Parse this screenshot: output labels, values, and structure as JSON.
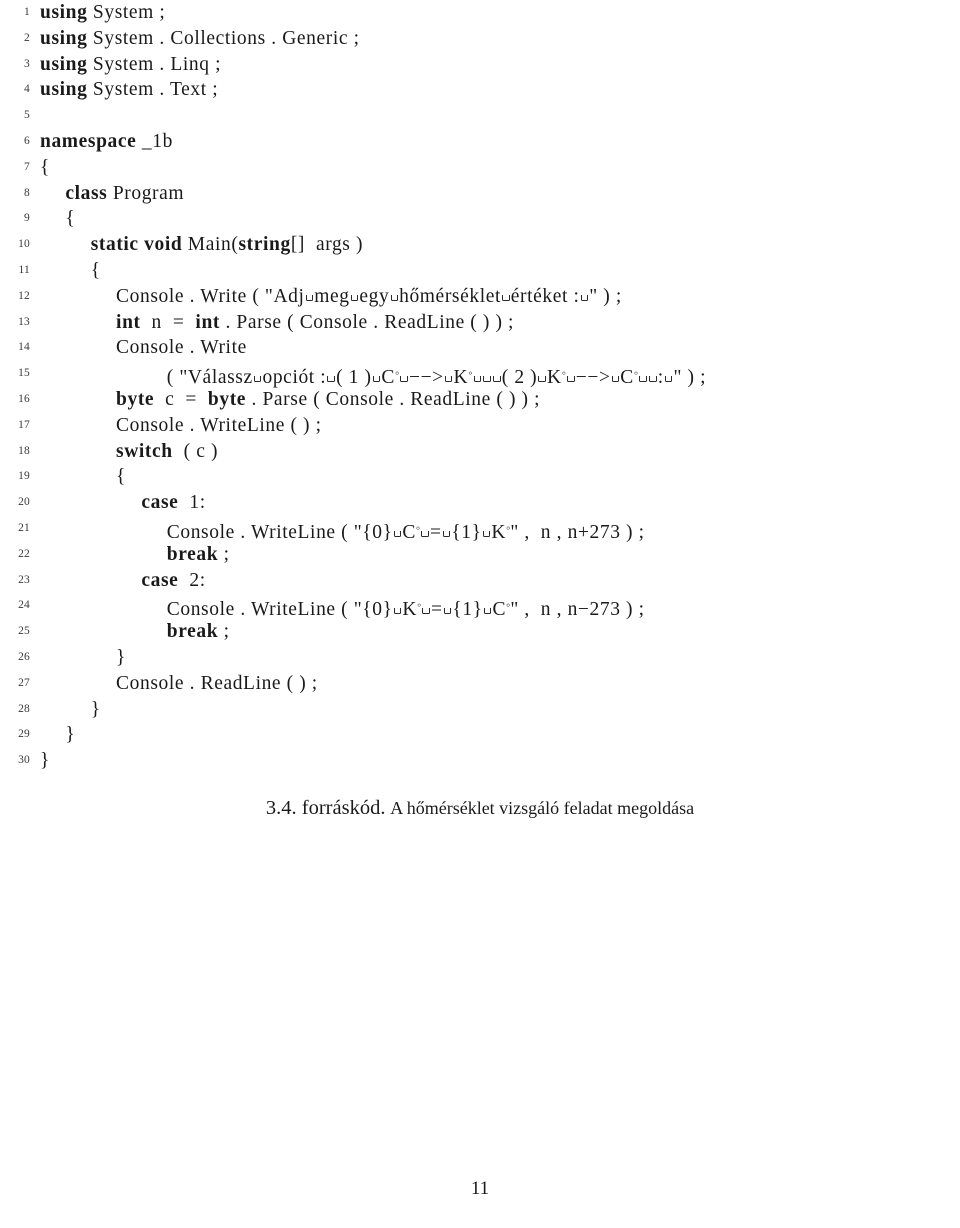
{
  "document": {
    "kind": "latex-code-listing",
    "language": "C#",
    "page_number": "11"
  },
  "listing": {
    "lines": [
      {
        "no": "1",
        "indent": 0,
        "tokens": [
          {
            "t": "kw",
            "v": "using"
          },
          {
            "t": "id",
            "v": " System ;"
          }
        ]
      },
      {
        "no": "2",
        "indent": 0,
        "tokens": [
          {
            "t": "kw",
            "v": "using"
          },
          {
            "t": "id",
            "v": " System . Collections . Generic ;"
          }
        ]
      },
      {
        "no": "3",
        "indent": 0,
        "tokens": [
          {
            "t": "kw",
            "v": "using"
          },
          {
            "t": "id",
            "v": " System . Linq ;"
          }
        ]
      },
      {
        "no": "4",
        "indent": 0,
        "tokens": [
          {
            "t": "kw",
            "v": "using"
          },
          {
            "t": "id",
            "v": " System . Text ;"
          }
        ]
      },
      {
        "no": "5",
        "indent": 0,
        "tokens": []
      },
      {
        "no": "6",
        "indent": 0,
        "tokens": [
          {
            "t": "kw",
            "v": "namespace"
          },
          {
            "t": "id",
            "v": " _1b"
          }
        ]
      },
      {
        "no": "7",
        "indent": 0,
        "tokens": [
          {
            "t": "id",
            "v": "{"
          }
        ]
      },
      {
        "no": "8",
        "indent": 1,
        "tokens": [
          {
            "t": "kw",
            "v": "class"
          },
          {
            "t": "id",
            "v": " Program"
          }
        ]
      },
      {
        "no": "9",
        "indent": 1,
        "tokens": [
          {
            "t": "id",
            "v": "{"
          }
        ]
      },
      {
        "no": "10",
        "indent": 2,
        "tokens": [
          {
            "t": "kw",
            "v": "static void"
          },
          {
            "t": "id",
            "v": " Main("
          },
          {
            "t": "kw",
            "v": "string"
          },
          {
            "t": "id",
            "v": "[]  args )"
          }
        ]
      },
      {
        "no": "11",
        "indent": 2,
        "tokens": [
          {
            "t": "id",
            "v": "{"
          }
        ]
      },
      {
        "no": "12",
        "indent": 3,
        "tokens": [
          {
            "t": "id",
            "v": "Console . Write ( \"Adj"
          },
          {
            "t": "sp"
          },
          {
            "t": "id",
            "v": "meg"
          },
          {
            "t": "sp"
          },
          {
            "t": "id",
            "v": "egy"
          },
          {
            "t": "sp"
          },
          {
            "t": "id",
            "v": "hőmérséklet"
          },
          {
            "t": "sp"
          },
          {
            "t": "id",
            "v": "értéket :"
          },
          {
            "t": "sp"
          },
          {
            "t": "id",
            "v": "\" ) ;"
          }
        ]
      },
      {
        "no": "13",
        "indent": 3,
        "tokens": [
          {
            "t": "kw",
            "v": "int"
          },
          {
            "t": "id",
            "v": "  n  =  "
          },
          {
            "t": "kw",
            "v": "int"
          },
          {
            "t": "id",
            "v": " . Parse ( Console . ReadLine ( ) ) ;"
          }
        ]
      },
      {
        "no": "14",
        "indent": 3,
        "tokens": [
          {
            "t": "id",
            "v": "Console . Write"
          }
        ]
      },
      {
        "no": "15",
        "indent": 5,
        "tokens": [
          {
            "t": "id",
            "v": "( \"Válassz"
          },
          {
            "t": "sp"
          },
          {
            "t": "id",
            "v": "opciót :"
          },
          {
            "t": "sp"
          },
          {
            "t": "id",
            "v": "( 1 )"
          },
          {
            "t": "sp"
          },
          {
            "t": "id",
            "v": "C"
          },
          {
            "t": "deg"
          },
          {
            "t": "sp"
          },
          {
            "t": "id",
            "v": "−−>"
          },
          {
            "t": "sp"
          },
          {
            "t": "id",
            "v": "K"
          },
          {
            "t": "deg"
          },
          {
            "t": "sp"
          },
          {
            "t": "sp"
          },
          {
            "t": "sp"
          },
          {
            "t": "id",
            "v": "( 2 )"
          },
          {
            "t": "sp"
          },
          {
            "t": "id",
            "v": "K"
          },
          {
            "t": "deg"
          },
          {
            "t": "sp"
          },
          {
            "t": "id",
            "v": "−−>"
          },
          {
            "t": "sp"
          },
          {
            "t": "id",
            "v": "C"
          },
          {
            "t": "deg"
          },
          {
            "t": "sp"
          },
          {
            "t": "sp"
          },
          {
            "t": "id",
            "v": ":"
          },
          {
            "t": "sp"
          },
          {
            "t": "id",
            "v": "\" ) ;"
          }
        ]
      },
      {
        "no": "16",
        "indent": 3,
        "tokens": [
          {
            "t": "kw",
            "v": "byte"
          },
          {
            "t": "id",
            "v": "  c  =  "
          },
          {
            "t": "kw",
            "v": "byte"
          },
          {
            "t": "id",
            "v": " . Parse ( Console . ReadLine ( ) ) ;"
          }
        ]
      },
      {
        "no": "17",
        "indent": 3,
        "tokens": [
          {
            "t": "id",
            "v": "Console . WriteLine ( ) ;"
          }
        ]
      },
      {
        "no": "18",
        "indent": 3,
        "tokens": [
          {
            "t": "kw",
            "v": "switch"
          },
          {
            "t": "id",
            "v": "  ( c )"
          }
        ]
      },
      {
        "no": "19",
        "indent": 3,
        "tokens": [
          {
            "t": "id",
            "v": "{"
          }
        ]
      },
      {
        "no": "20",
        "indent": 4,
        "tokens": [
          {
            "t": "kw",
            "v": "case"
          },
          {
            "t": "id",
            "v": "  1:"
          }
        ]
      },
      {
        "no": "21",
        "indent": 5,
        "tokens": [
          {
            "t": "id",
            "v": "Console . WriteLine ( \"{0}"
          },
          {
            "t": "sp"
          },
          {
            "t": "id",
            "v": "C"
          },
          {
            "t": "deg"
          },
          {
            "t": "sp"
          },
          {
            "t": "id",
            "v": "="
          },
          {
            "t": "sp"
          },
          {
            "t": "id",
            "v": "{1}"
          },
          {
            "t": "sp"
          },
          {
            "t": "id",
            "v": "K"
          },
          {
            "t": "deg"
          },
          {
            "t": "id",
            "v": "\" ,  n , n+273 ) ;"
          }
        ]
      },
      {
        "no": "22",
        "indent": 5,
        "tokens": [
          {
            "t": "kw",
            "v": "break"
          },
          {
            "t": "id",
            "v": " ;"
          }
        ]
      },
      {
        "no": "23",
        "indent": 4,
        "tokens": [
          {
            "t": "kw",
            "v": "case"
          },
          {
            "t": "id",
            "v": "  2:"
          }
        ]
      },
      {
        "no": "24",
        "indent": 5,
        "tokens": [
          {
            "t": "id",
            "v": "Console . WriteLine ( \"{0}"
          },
          {
            "t": "sp"
          },
          {
            "t": "id",
            "v": "K"
          },
          {
            "t": "deg"
          },
          {
            "t": "sp"
          },
          {
            "t": "id",
            "v": "="
          },
          {
            "t": "sp"
          },
          {
            "t": "id",
            "v": "{1}"
          },
          {
            "t": "sp"
          },
          {
            "t": "id",
            "v": "C"
          },
          {
            "t": "deg"
          },
          {
            "t": "id",
            "v": "\" ,  n , n−273 ) ;"
          }
        ]
      },
      {
        "no": "25",
        "indent": 5,
        "tokens": [
          {
            "t": "kw",
            "v": "break"
          },
          {
            "t": "id",
            "v": " ;"
          }
        ]
      },
      {
        "no": "26",
        "indent": 3,
        "tokens": [
          {
            "t": "id",
            "v": "}"
          }
        ]
      },
      {
        "no": "27",
        "indent": 3,
        "tokens": [
          {
            "t": "id",
            "v": "Console . ReadLine ( ) ;"
          }
        ]
      },
      {
        "no": "28",
        "indent": 2,
        "tokens": [
          {
            "t": "id",
            "v": "}"
          }
        ]
      },
      {
        "no": "29",
        "indent": 1,
        "tokens": [
          {
            "t": "id",
            "v": "}"
          }
        ]
      },
      {
        "no": "30",
        "indent": 0,
        "tokens": [
          {
            "t": "id",
            "v": "}"
          }
        ]
      }
    ]
  },
  "caption": {
    "number": "3.4. forráskód.",
    "text": "A hőmérséklet vizsgáló feladat megoldása"
  },
  "folio": {
    "page": "11"
  },
  "colors": {
    "text": "#1a1a1a",
    "lineno": "#3b3b3b",
    "background": "#ffffff"
  }
}
